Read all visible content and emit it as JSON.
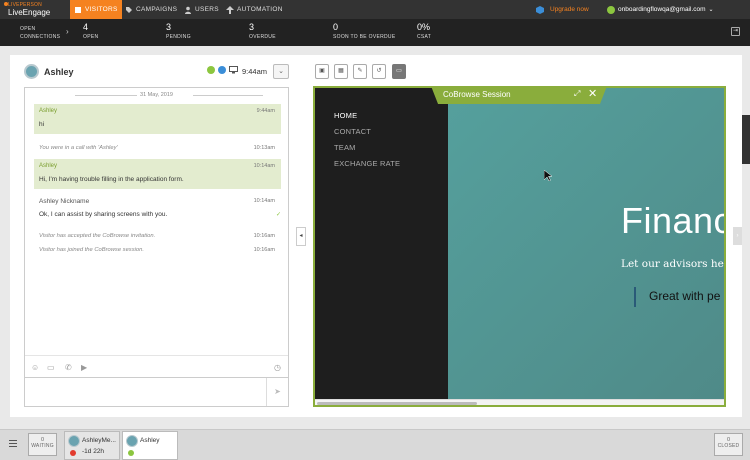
{
  "nav": {
    "logo_top": "LIVEPERSON",
    "logo_bottom": "LiveEngage",
    "tabs": [
      {
        "label": "VISITORS",
        "icon": "orange-visitors-icon"
      },
      {
        "label": "CAMPAIGNS",
        "icon": "tag-icon"
      },
      {
        "label": "USERS",
        "icon": "user-icon"
      },
      {
        "label": "AUTOMATION",
        "icon": "automation-icon"
      }
    ],
    "upgrade": "Upgrade now",
    "account": "onboardingflowqa@gmail.com"
  },
  "stats": {
    "open_connections_label": "OPEN CONNECTIONS",
    "items": [
      {
        "value": "4",
        "label": "OPEN"
      },
      {
        "value": "3",
        "label": "PENDING"
      },
      {
        "value": "3",
        "label": "OVERDUE"
      },
      {
        "value": "0",
        "label": "SOON TO BE OVERDUE"
      },
      {
        "value": "0%",
        "label": "CSAT"
      }
    ]
  },
  "visitor": {
    "name": "Ashley",
    "time": "9:44am"
  },
  "chat": {
    "date": "31 May, 2019",
    "messages": [
      {
        "type": "visitor",
        "name": "Ashley",
        "time": "9:44am",
        "text": "hi"
      },
      {
        "type": "system",
        "time": "10:13am",
        "text": "You were in a call with 'Ashley'"
      },
      {
        "type": "visitor",
        "name": "Ashley",
        "time": "10:14am",
        "text": "Hi, I'm having trouble filling in the application form."
      },
      {
        "type": "agent",
        "name": "Ashley Nickname",
        "time": "10:14am",
        "text": "Ok, I can assist by sharing screens with you."
      },
      {
        "type": "system",
        "time": "10:16am",
        "text": "Visitor has accepted the CoBrowse invitation."
      },
      {
        "type": "system",
        "time": "10:16am",
        "text": "Visitor has joined the CoBrowse session."
      }
    ]
  },
  "cobrowse": {
    "header": "CoBrowse Session",
    "nav": [
      "HOME",
      "CONTACT",
      "TEAM",
      "EXCHANGE RATE"
    ],
    "hero_title": "Financ",
    "hero_sub": "Let our advisors help",
    "hero_quote": "Great with pe"
  },
  "bottom": {
    "waiting_count": "0",
    "waiting_label": "WAITING",
    "closed_count": "0",
    "closed_label": "CLOSED",
    "tabs": [
      {
        "name": "AshleyMe...",
        "sub": "-1d 22h"
      },
      {
        "name": "Ashley",
        "sub": ""
      }
    ]
  },
  "colors": {
    "accent": "#f58220",
    "cobrowse": "#8aad3c",
    "hero": "#55a09d"
  }
}
